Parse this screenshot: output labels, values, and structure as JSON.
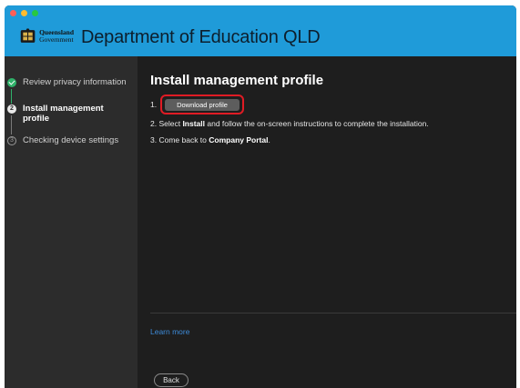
{
  "header": {
    "logo_line1": "Queensland",
    "logo_line2": "Government",
    "title": "Department of Education QLD",
    "brand_color": "#1f9bd9"
  },
  "sidebar": {
    "steps": [
      {
        "label": "Review privacy information",
        "state": "completed",
        "icon": "check-circle-icon"
      },
      {
        "label": "Install management profile",
        "state": "current",
        "number": "2"
      },
      {
        "label": "Checking device settings",
        "state": "pending",
        "number": "3"
      }
    ]
  },
  "main": {
    "title": "Install management profile",
    "step1_prefix": "1.",
    "download_button": "Download profile",
    "step2_prefix": "2. Select ",
    "step2_bold": "Install",
    "step2_suffix": " and follow the on-screen instructions to complete the installation.",
    "step3_prefix": "3. Come back to ",
    "step3_bold": "Company Portal",
    "step3_suffix": ".",
    "learn_more": "Learn more",
    "back_button": "Back"
  },
  "colors": {
    "highlight_border": "#e01b24",
    "success": "#2fb26a",
    "link": "#3d8bd9"
  }
}
